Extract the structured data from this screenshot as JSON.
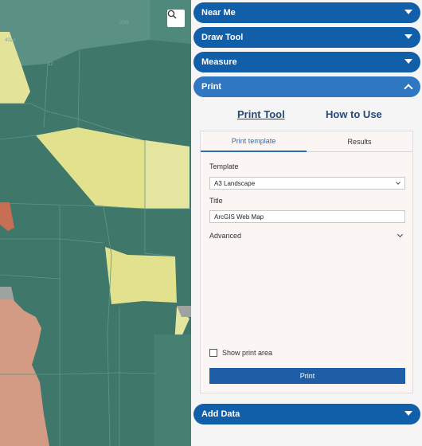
{
  "map": {
    "search_icon": "search-icon",
    "labels": [
      "20/3",
      "4024",
      "12"
    ]
  },
  "panel": {
    "sections": [
      {
        "label": "Near Me",
        "state": "collapsed"
      },
      {
        "label": "Draw Tool",
        "state": "collapsed"
      },
      {
        "label": "Measure",
        "state": "collapsed"
      },
      {
        "label": "Print",
        "state": "expanded"
      }
    ],
    "add_data": {
      "label": "Add Data",
      "state": "collapsed"
    }
  },
  "print": {
    "links": {
      "print_tool": "Print Tool",
      "how_to_use": "How to Use"
    },
    "tabs": [
      "Print template",
      "Results"
    ],
    "template_label": "Template",
    "template_value": "A3 Landscape",
    "title_label": "Title",
    "title_value": "ArcGIS Web Map",
    "advanced_label": "Advanced",
    "show_area_label": "Show print area",
    "print_button": "Print"
  },
  "colors": {
    "accordion": "#125fa9",
    "accordion_open": "#2f77c1",
    "teal": "#3e7669",
    "yellow": "#e2e28e",
    "salmon": "#d39a84",
    "rust": "#c66f55"
  }
}
